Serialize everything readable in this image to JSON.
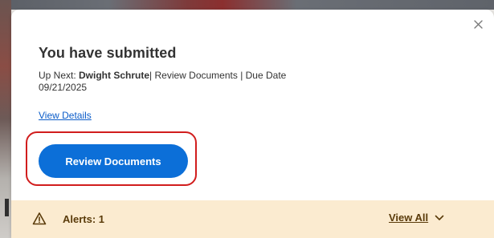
{
  "dialog": {
    "title": "You have submitted",
    "up_next_prefix": "Up Next: ",
    "up_next_name": "Dwight Schrute",
    "up_next_details": "| Review Documents | Due Date",
    "due_date": "09/21/2025",
    "view_details_label": "View Details",
    "primary_button_label": "Review Documents",
    "close_icon": "close-icon"
  },
  "alerts": {
    "label": "Alerts: 1",
    "view_all_label": "View All",
    "icon": "warning-triangle-icon",
    "chevron_icon": "chevron-down-icon"
  },
  "colors": {
    "primary_button": "#0c6fd8",
    "link": "#0b5cc9",
    "highlight_outline": "#d11d1d",
    "alerts_background": "#fbebd0",
    "alerts_text": "#5a3b0a"
  }
}
